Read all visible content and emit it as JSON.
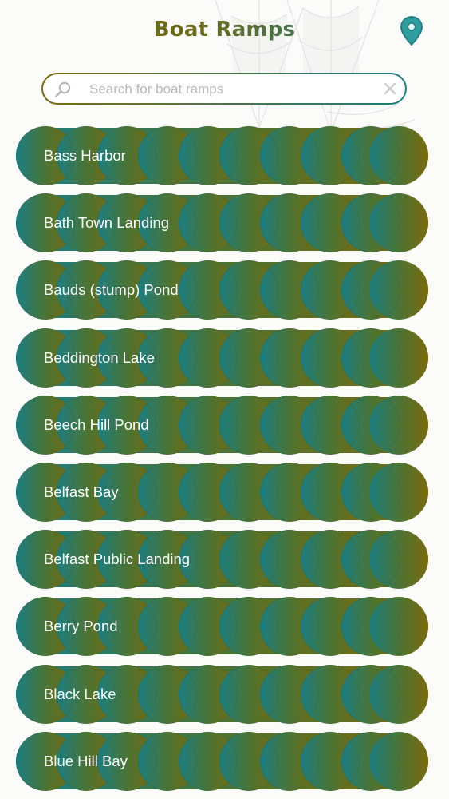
{
  "header": {
    "title": "Boat Ramps",
    "location_icon": "map-pin-icon"
  },
  "search": {
    "placeholder": "Search for boat ramps",
    "value": "",
    "icon": "search-icon",
    "clear_icon": "close-icon"
  },
  "colors": {
    "gradient_start": "#1a7e82",
    "gradient_end": "#7b6a0c",
    "label_text": "#ffffff",
    "background": "#fbfbfa"
  },
  "ramps": [
    {
      "label": "Bass Harbor"
    },
    {
      "label": "Bath Town Landing"
    },
    {
      "label": "Bauds (stump) Pond"
    },
    {
      "label": "Beddington Lake"
    },
    {
      "label": "Beech Hill Pond"
    },
    {
      "label": "Belfast Bay"
    },
    {
      "label": "Belfast Public Landing"
    },
    {
      "label": "Berry Pond"
    },
    {
      "label": "Black Lake"
    },
    {
      "label": "Blue Hill Bay"
    }
  ]
}
